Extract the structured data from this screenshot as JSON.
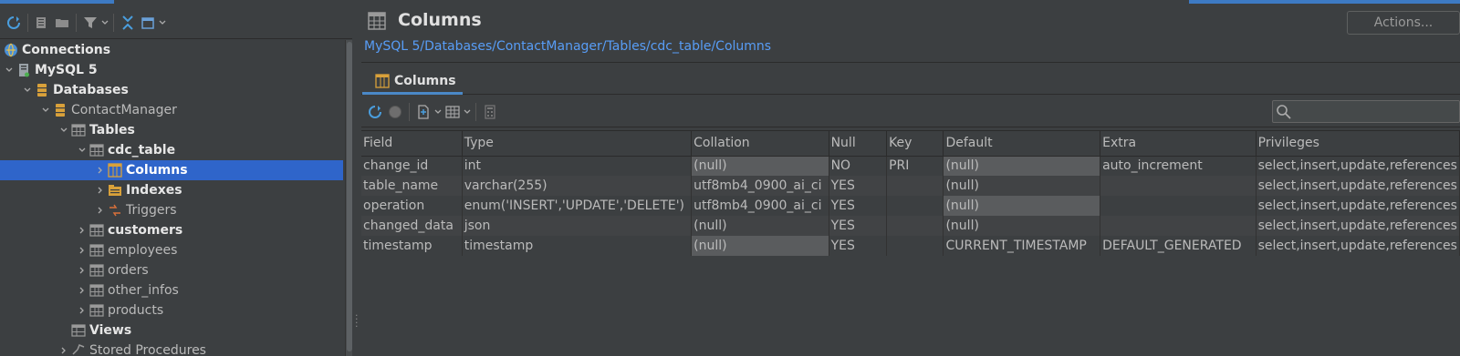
{
  "sidebar": {
    "root_label": "Connections",
    "tree": [
      {
        "label": "Connections",
        "bold": true,
        "level": 0,
        "chevron": "",
        "icon": "connections-icon",
        "selected": false
      },
      {
        "label": "MySQL 5",
        "bold": true,
        "level": 0,
        "chevron": "down",
        "icon": "server-icon",
        "selected": false
      },
      {
        "label": "Databases",
        "bold": true,
        "level": 1,
        "chevron": "down",
        "icon": "database-icon",
        "selected": false
      },
      {
        "label": "ContactManager",
        "bold": false,
        "level": 2,
        "chevron": "down",
        "icon": "database-icon",
        "selected": false
      },
      {
        "label": "Tables",
        "bold": true,
        "level": 3,
        "chevron": "down",
        "icon": "table-icon",
        "selected": false
      },
      {
        "label": "cdc_table",
        "bold": true,
        "level": 4,
        "chevron": "down",
        "icon": "table-icon",
        "selected": false
      },
      {
        "label": "Columns",
        "bold": true,
        "level": 5,
        "chevron": "right",
        "icon": "columns-icon",
        "selected": true
      },
      {
        "label": "Indexes",
        "bold": true,
        "level": 5,
        "chevron": "right",
        "icon": "indexes-icon",
        "selected": false
      },
      {
        "label": "Triggers",
        "bold": false,
        "level": 5,
        "chevron": "right",
        "icon": "triggers-icon",
        "selected": false
      },
      {
        "label": "customers",
        "bold": true,
        "level": 4,
        "chevron": "right",
        "icon": "table-icon",
        "selected": false
      },
      {
        "label": "employees",
        "bold": false,
        "level": 4,
        "chevron": "right",
        "icon": "table-icon",
        "selected": false
      },
      {
        "label": "orders",
        "bold": false,
        "level": 4,
        "chevron": "right",
        "icon": "table-icon",
        "selected": false
      },
      {
        "label": "other_infos",
        "bold": false,
        "level": 4,
        "chevron": "right",
        "icon": "table-icon",
        "selected": false
      },
      {
        "label": "products",
        "bold": false,
        "level": 4,
        "chevron": "right",
        "icon": "table-icon",
        "selected": false
      },
      {
        "label": "Views",
        "bold": true,
        "level": 3,
        "chevron": "",
        "icon": "views-icon",
        "selected": false
      },
      {
        "label": "Stored Procedures",
        "bold": false,
        "level": 3,
        "chevron": "right",
        "icon": "procedures-icon",
        "selected": false
      }
    ]
  },
  "editor": {
    "title": "Columns",
    "actions_label": "Actions...",
    "breadcrumb": "MySQL 5/Databases/ContactManager/Tables/cdc_table/Columns",
    "tab_label": "Columns"
  },
  "grid": {
    "columns": [
      "Field",
      "Type",
      "Collation",
      "Null",
      "Key",
      "Default",
      "Extra",
      "Privileges"
    ],
    "rows": [
      [
        "change_id",
        "int",
        "(null)",
        "NO",
        "PRI",
        "(null)",
        "auto_increment",
        "select,insert,update,references"
      ],
      [
        "table_name",
        "varchar(255)",
        "utf8mb4_0900_ai_ci",
        "YES",
        "",
        "(null)",
        "",
        "select,insert,update,references"
      ],
      [
        "operation",
        "enum('INSERT','UPDATE','DELETE')",
        "utf8mb4_0900_ai_ci",
        "YES",
        "",
        "(null)",
        "",
        "select,insert,update,references"
      ],
      [
        "changed_data",
        "json",
        "(null)",
        "YES",
        "",
        "(null)",
        "",
        "select,insert,update,references"
      ],
      [
        "timestamp",
        "timestamp",
        "(null)",
        "YES",
        "",
        "CURRENT_TIMESTAMP",
        "DEFAULT_GENERATED",
        "select,insert,update,references"
      ]
    ]
  },
  "colors": {
    "background": "#3c3f41",
    "selection": "#2f65ca",
    "link": "#589df6",
    "null_cell": "#5a5c5e",
    "accent": "#4a88c7"
  }
}
